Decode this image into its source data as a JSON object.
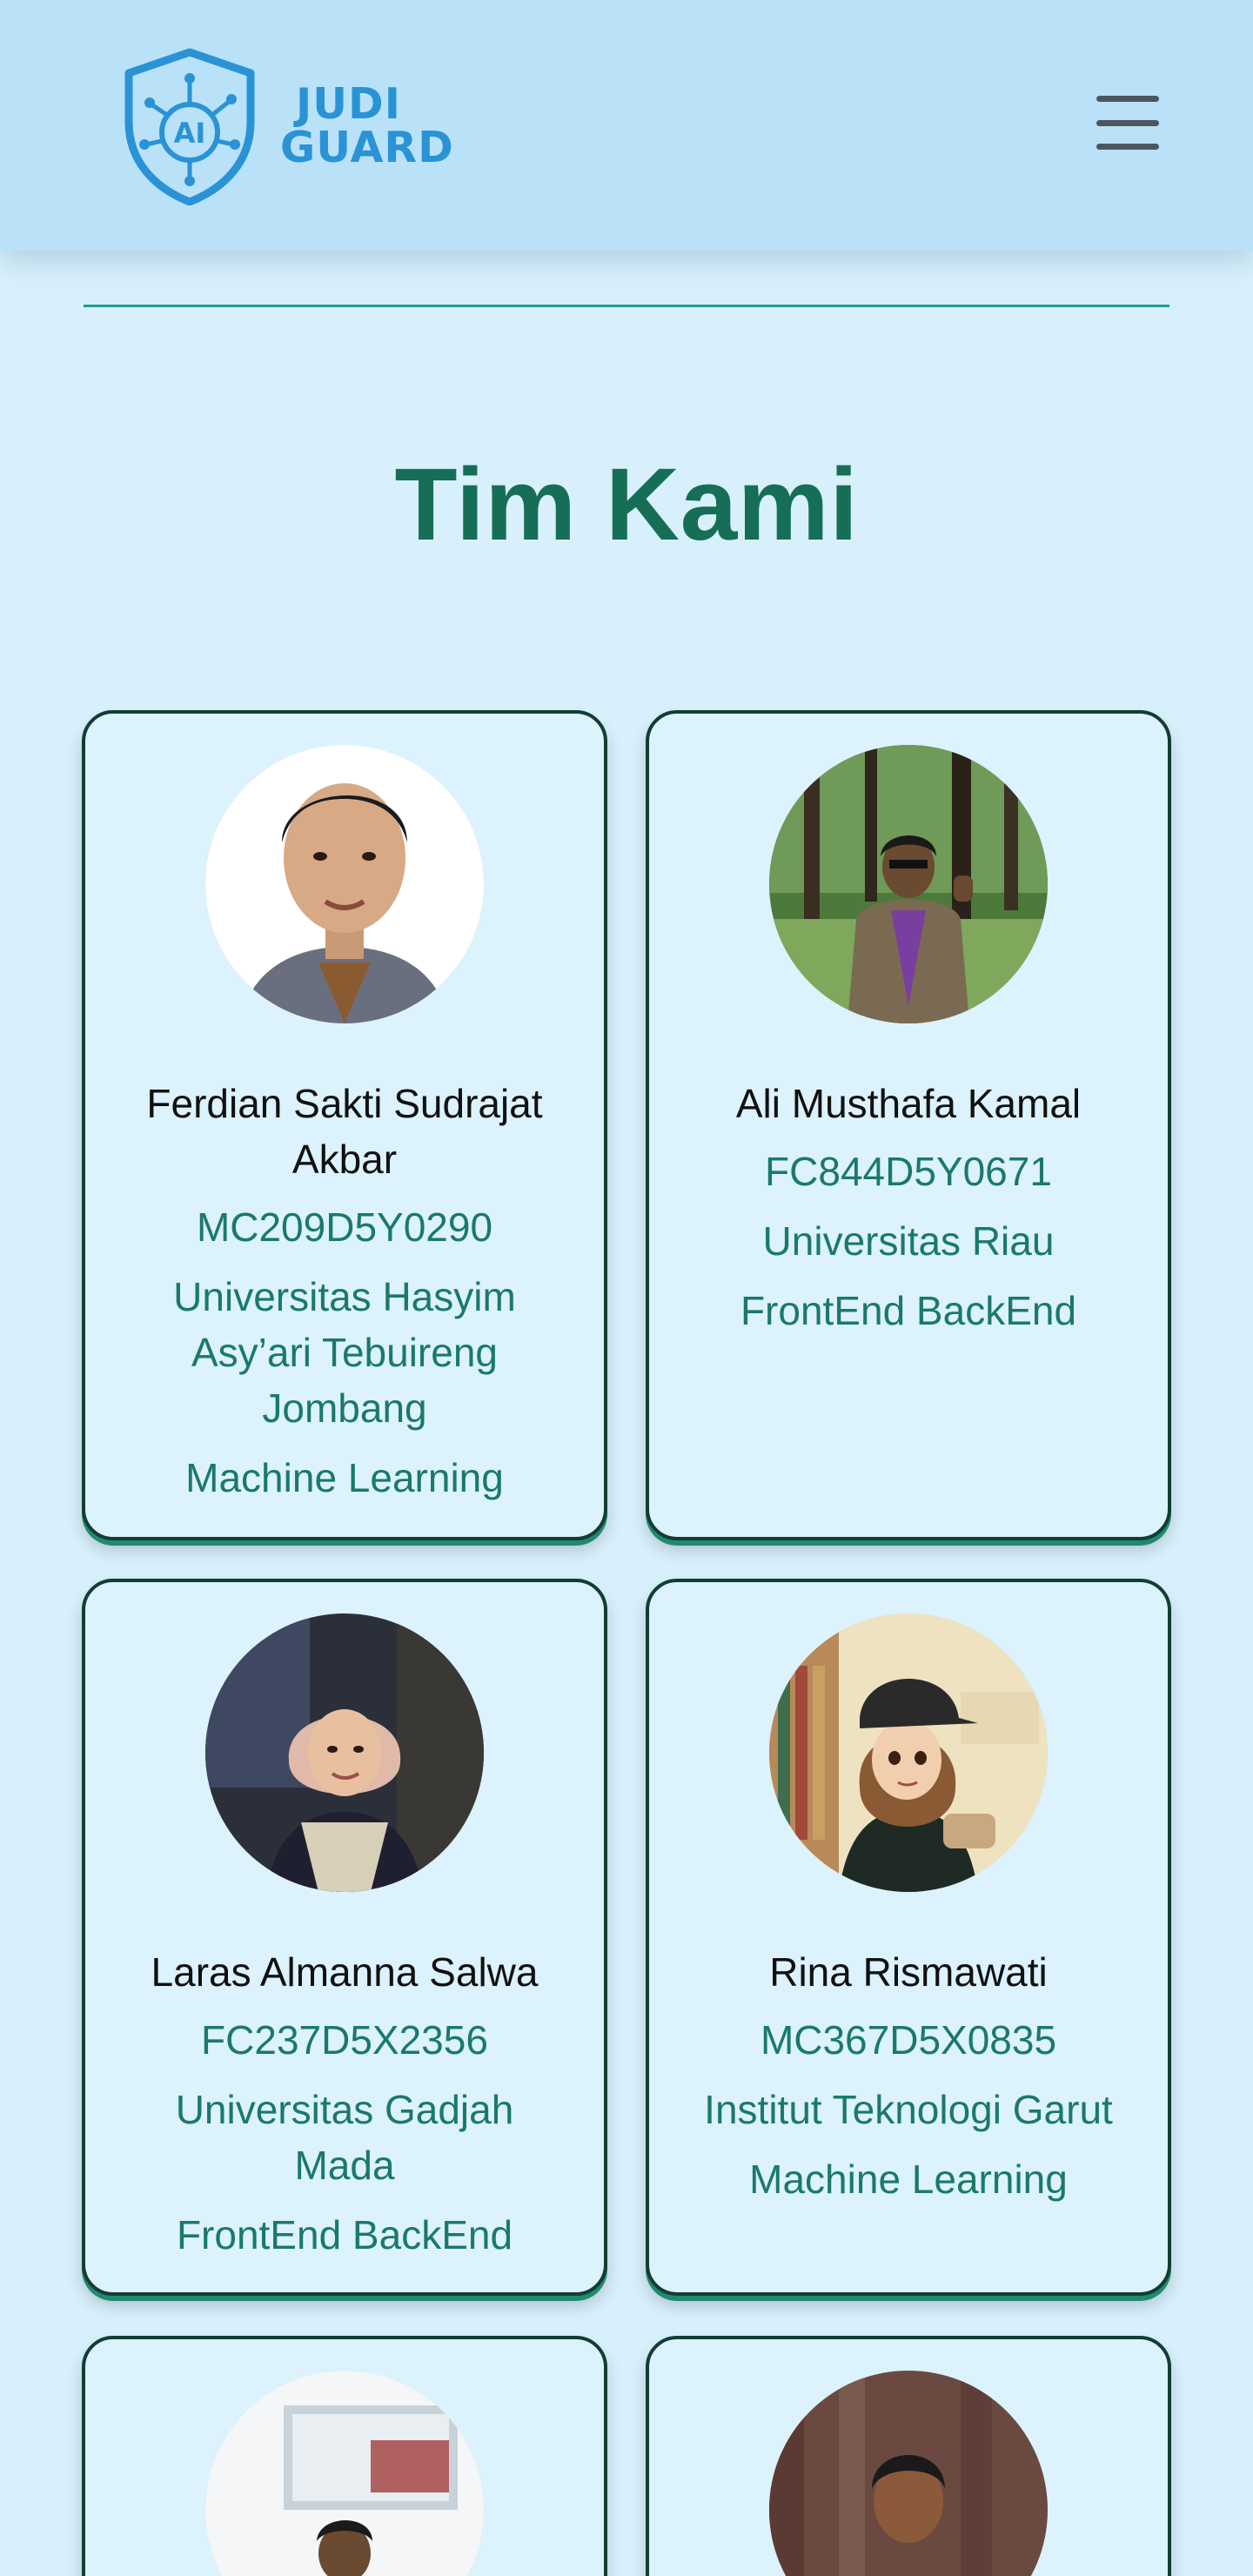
{
  "brand": {
    "line1": "JUDI",
    "line2": "GUARD",
    "badge": "AI",
    "color": "#2a93d5"
  },
  "nav": {
    "menu_icon": "hamburger-menu-icon"
  },
  "section": {
    "title": "Tim Kami"
  },
  "colors": {
    "background": "#d8f0fc",
    "navbar": "#b9e2f8",
    "title": "#176e56",
    "accent_text": "#1a7a66",
    "card_border": "#123d33"
  },
  "members": [
    {
      "name": "Ferdian Sakti Sudrajat Akbar",
      "id": "MC209D5Y0290",
      "university": "Universitas Hasyim Asy’ari Tebuireng Jombang",
      "role": "Machine Learning"
    },
    {
      "name": "Ali Musthafa Kamal",
      "id": "FC844D5Y0671",
      "university": "Universitas Riau",
      "role": "FrontEnd BackEnd"
    },
    {
      "name": "Laras Almanna Salwa",
      "id": "FC237D5X2356",
      "university": "Universitas Gadjah Mada",
      "role": "FrontEnd BackEnd"
    },
    {
      "name": "Rina Rismawati",
      "id": "MC367D5X0835",
      "university": "Institut Teknologi Garut",
      "role": "Machine Learning"
    }
  ]
}
